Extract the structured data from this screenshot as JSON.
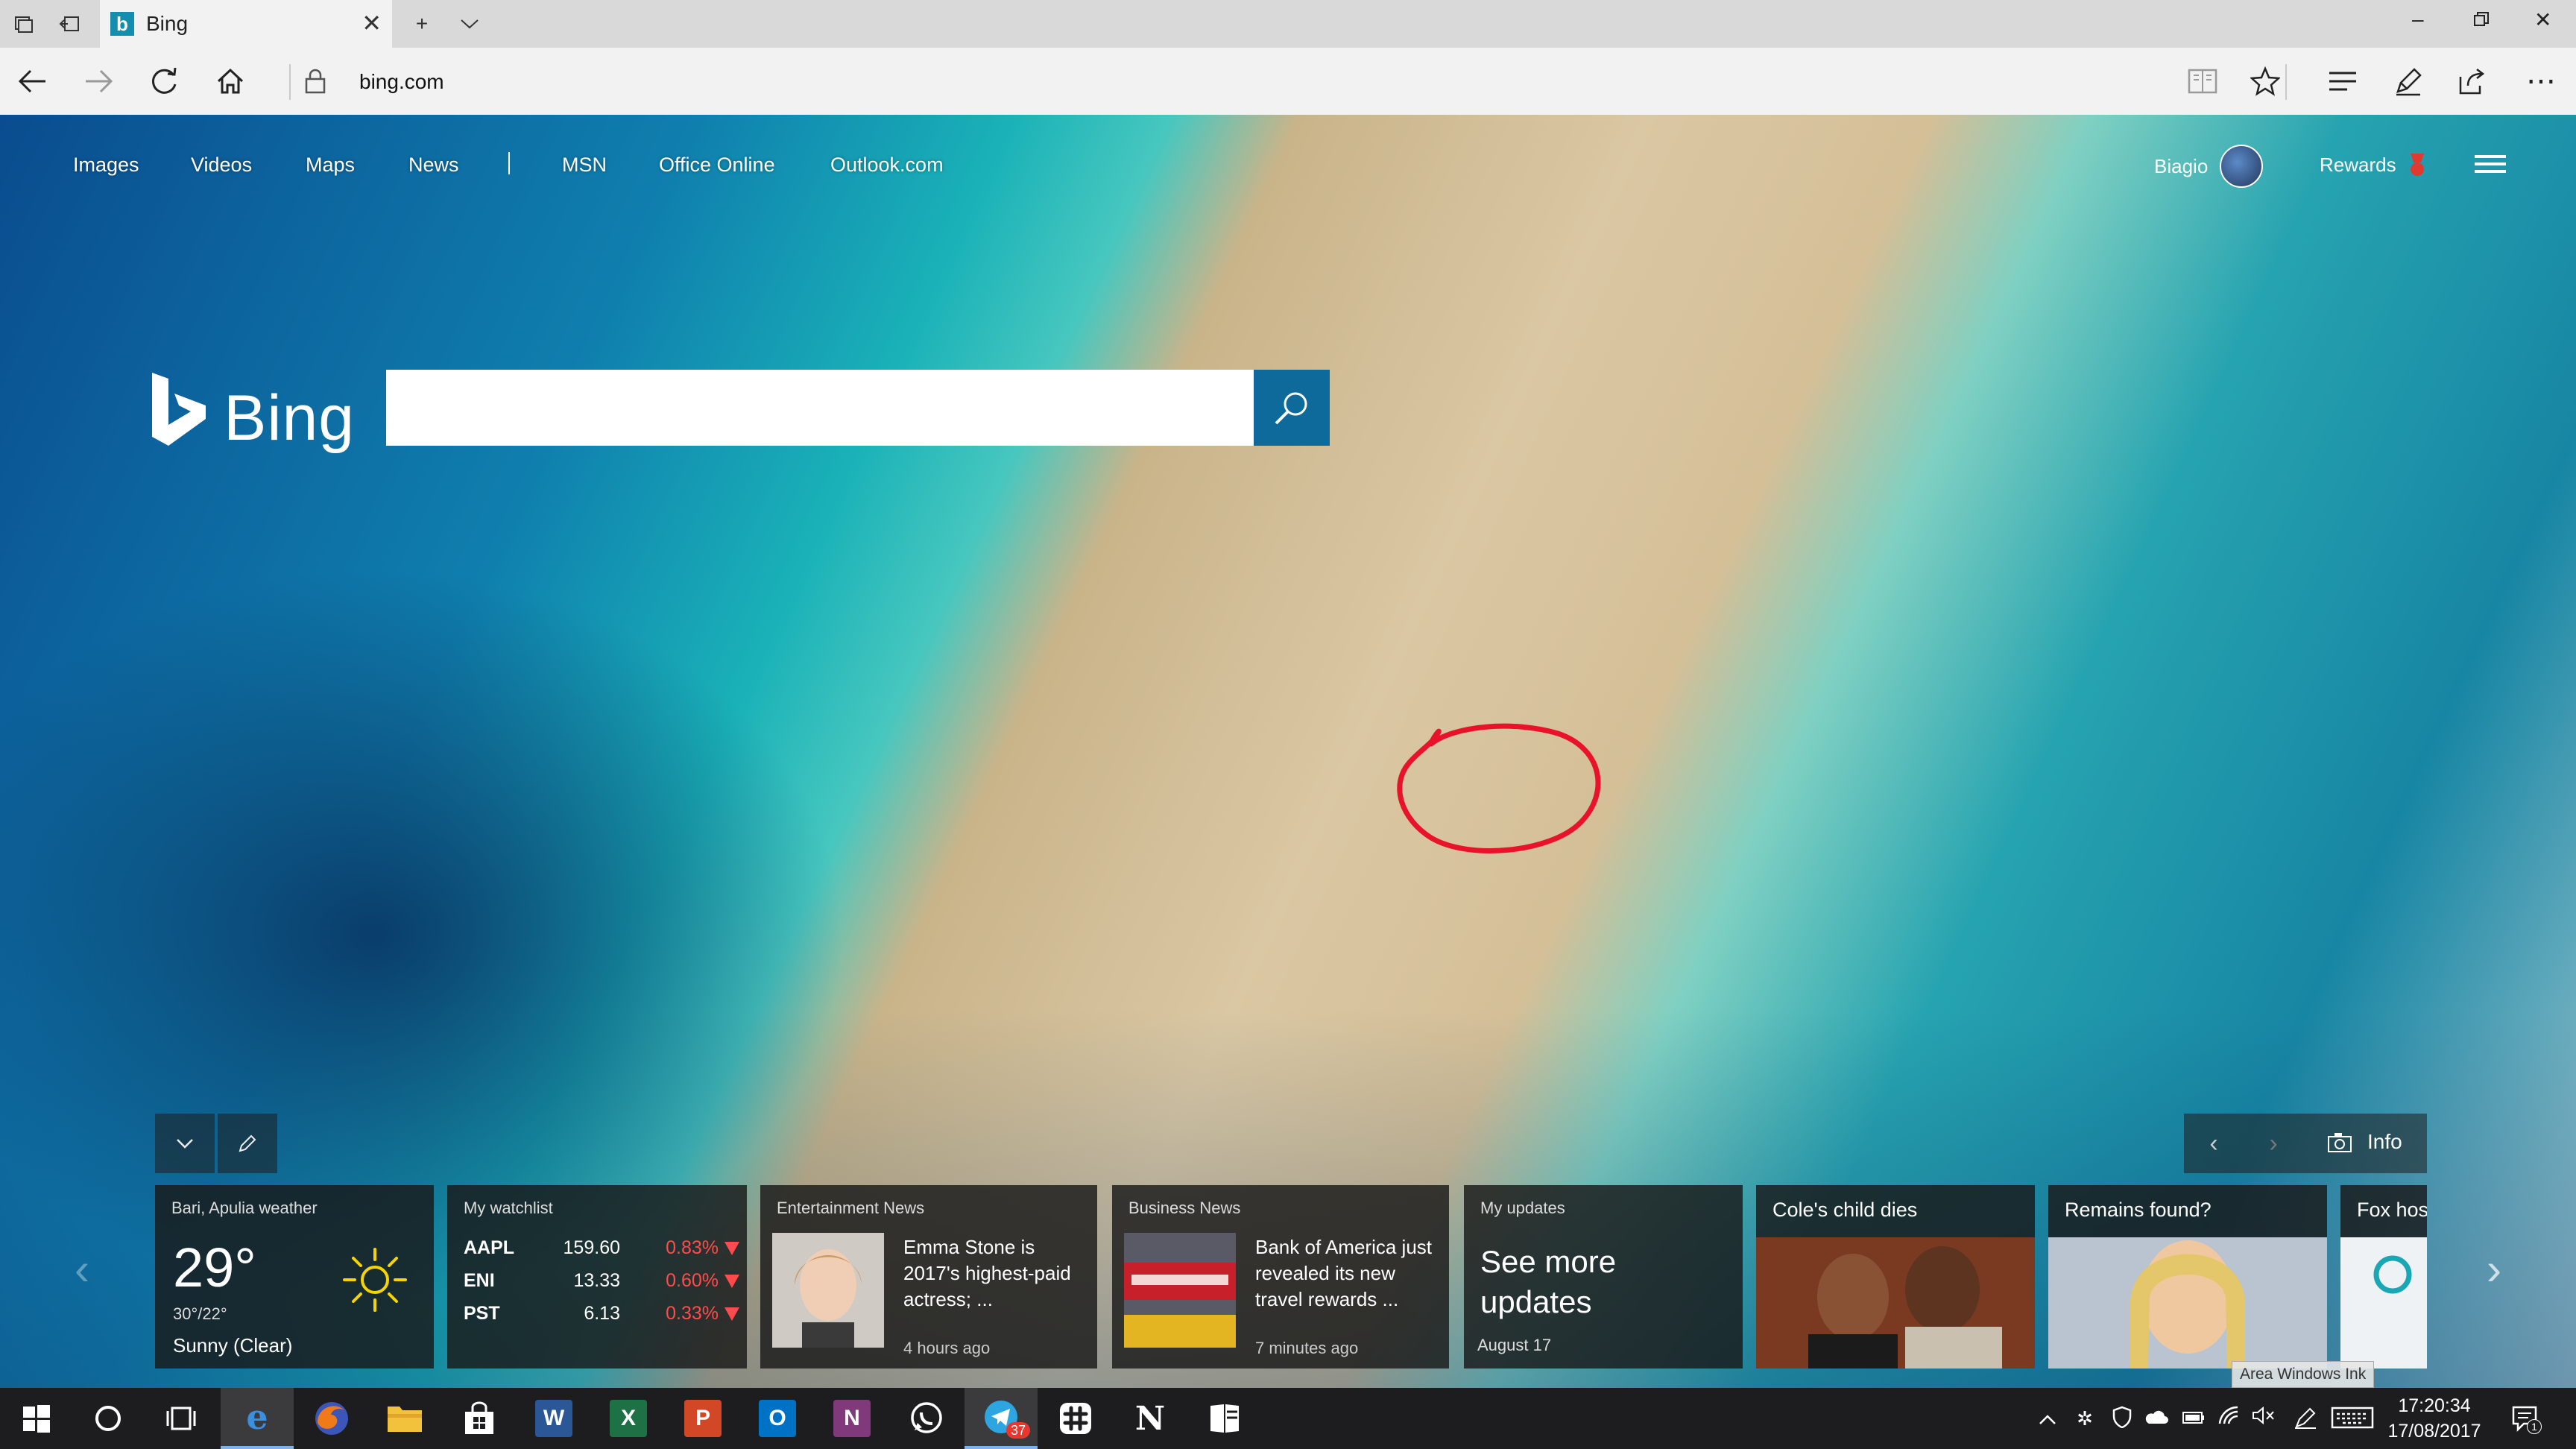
{
  "browser": {
    "tab_title": "Bing",
    "url": "bing.com"
  },
  "nav": {
    "links": [
      "Images",
      "Videos",
      "Maps",
      "News",
      "MSN",
      "Office Online",
      "Outlook.com"
    ],
    "user_name": "Biagio",
    "rewards_label": "Rewards"
  },
  "brand": {
    "name": "Bing",
    "accent": "#138eae",
    "search_button_color": "#0e6a9a"
  },
  "search": {
    "value": "",
    "placeholder": ""
  },
  "info": {
    "label": "Info"
  },
  "weather": {
    "head": "Bari, Apulia weather",
    "temp": "29°",
    "range": "30°/22°",
    "condition": "Sunny (Clear)"
  },
  "watchlist": {
    "head": "My watchlist",
    "rows": [
      {
        "symbol": "AAPL",
        "price": "159.60",
        "change": "0.83%"
      },
      {
        "symbol": "ENI",
        "price": "13.33",
        "change": "0.60%"
      },
      {
        "symbol": "PST",
        "price": "6.13",
        "change": "0.33%"
      }
    ],
    "down_color": "#ff4b4b"
  },
  "entertainment": {
    "head": "Entertainment News",
    "title": "Emma Stone is 2017's highest-paid actress; ...",
    "time": "4 hours ago"
  },
  "business": {
    "head": "Business News",
    "title": "Bank of America just revealed its new travel rewards ...",
    "time": "7 minutes ago"
  },
  "updates": {
    "head": "My updates",
    "big": "See more updates",
    "date": "August 17"
  },
  "photo_cards": [
    {
      "title": "Cole's child dies"
    },
    {
      "title": "Remains found?"
    },
    {
      "title": "Fox host"
    }
  ],
  "ink_tooltip": "Area Windows Ink",
  "taskbar": {
    "apps": [
      "start",
      "cortana",
      "task-view",
      "edge",
      "firefox",
      "file-explorer",
      "store",
      "word",
      "excel",
      "powerpoint",
      "outlook",
      "onenote",
      "whatsapp",
      "telegram",
      "slack",
      "notion",
      "windows-journal"
    ],
    "telegram_badge": "37",
    "time": "17:20:34",
    "date": "17/08/2017",
    "notification_count": "1"
  }
}
